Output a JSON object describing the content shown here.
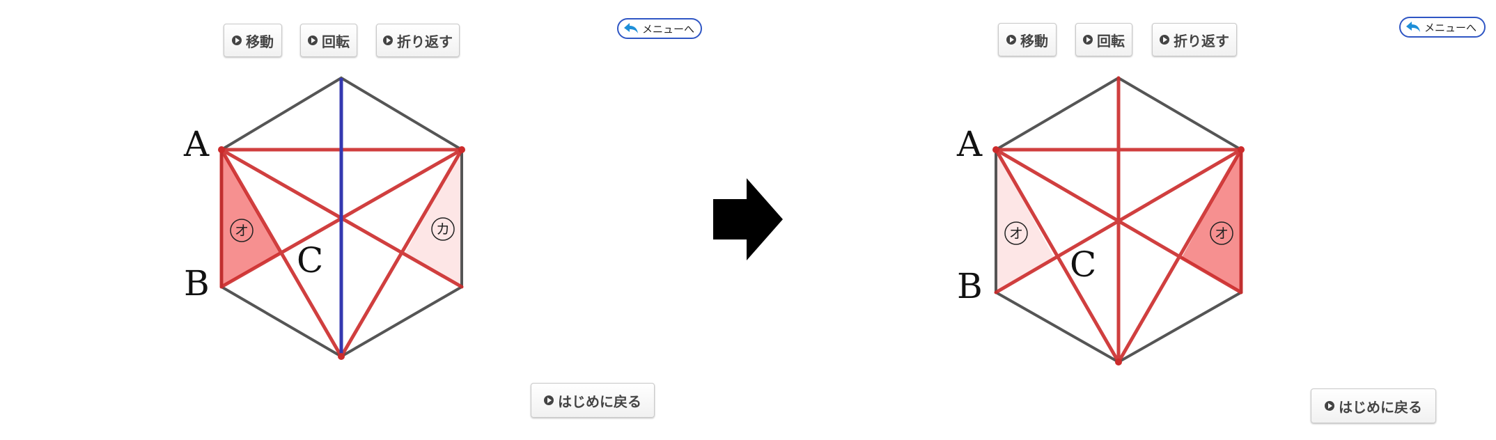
{
  "toolbar": {
    "move_label": "移動",
    "rotate_label": "回転",
    "fold_label": "折り返す"
  },
  "menu_label": "メニューへ",
  "reset_label": "はじめに戻る",
  "figure": {
    "vertex_a": "A",
    "vertex_b": "B",
    "vertex_c": "C",
    "region_o": "オ",
    "region_ka": "カ"
  },
  "colors": {
    "hexagon": "#555555",
    "diagonal": "#cc2b2b",
    "axis": "#3438b0",
    "filled": "#f47c7c",
    "light_fill": "#fde6e6",
    "menu_border": "#2f56c4",
    "menu_icon": "#1e8fd8"
  },
  "icons": [
    "play-icon",
    "back-arrow-icon",
    "right-arrow-icon"
  ]
}
